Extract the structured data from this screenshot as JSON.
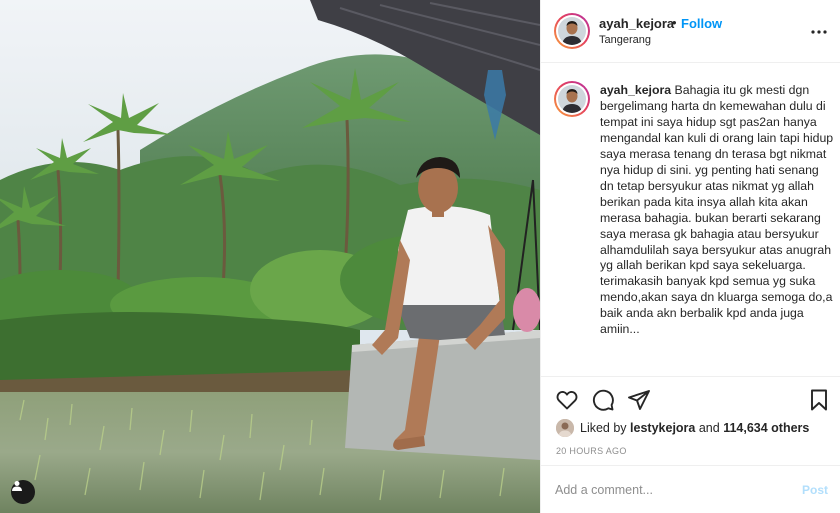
{
  "header": {
    "username": "ayah_kejora",
    "separator": "•",
    "follow_label": "Follow",
    "location": "Tangerang"
  },
  "caption": {
    "username": "ayah_kejora",
    "text": "Bahagia itu gk mesti dgn bergelimang harta dn kemewahan dulu di tempat ini saya hidup sgt pas2an hanya mengandal kan kuli di orang lain tapi hidup saya merasa tenang dn terasa bgt nikmat nya hidup di sini. yg penting hati senang dn tetap bersyukur atas nikmat yg allah berikan pada kita insya allah kita akan merasa bahagia. bukan berarti sekarang saya merasa gk bahagia atau bersyukur alhamdulilah saya bersyukur atas anugrah yg allah berikan kpd saya sekeluarga. terimakasih banyak kpd semua yg suka mendo,akan saya dn kluarga semoga do,a baik anda akn berbalik kpd anda juga amiin..."
  },
  "likes": {
    "prefix": "Liked by",
    "first_user": "lestykejora",
    "connector": "and",
    "others": "114,634 others"
  },
  "timestamp": "20 HOURS AGO",
  "comment": {
    "placeholder": "Add a comment...",
    "post_label": "Post"
  },
  "icons": {
    "more": "more-options-icon",
    "like": "heart-icon",
    "comment": "comment-icon",
    "share": "send-icon",
    "save": "bookmark-icon",
    "tag": "user-tag-icon"
  },
  "colors": {
    "follow": "#0095f6",
    "post_disabled": "#b2dffc",
    "muted": "#8e8e8e",
    "text": "#262626",
    "border": "#efefef"
  }
}
